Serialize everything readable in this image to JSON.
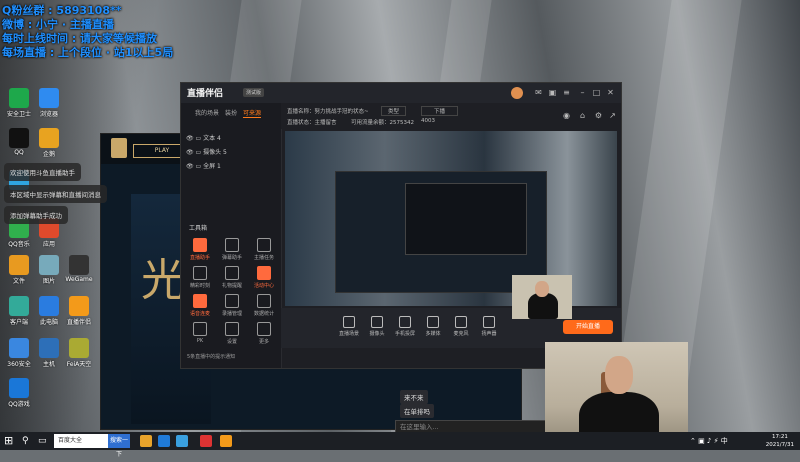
{
  "overlay": {
    "line1": "Q粉丝群 : 5893108**",
    "line2": "微博 : 小宁 · 主播直播",
    "line3": "每时上线时间 : 请大家等候播放",
    "line4": "每场直播 : 上个段位 · 站1以上5局"
  },
  "desktop_icons": [
    {
      "label": "安全卫士",
      "color": "#1ea84b"
    },
    {
      "label": "浏览器",
      "color": "#2f8bf0"
    },
    {
      "label": "QQ",
      "color": "#111"
    },
    {
      "label": "企鹅",
      "color": "#e8a320"
    },
    {
      "label": "TIM",
      "color": "#2fa5e0"
    },
    {
      "label": "QQ音乐",
      "color": "#30b04d"
    },
    {
      "label": "应用",
      "color": "#e04a2c"
    },
    {
      "label": "文件",
      "color": "#e89a20"
    },
    {
      "label": "图片",
      "color": "#7ab"
    },
    {
      "label": "WeGame",
      "color": "#333"
    },
    {
      "label": "客户端",
      "color": "#3a9"
    },
    {
      "label": "此电脑",
      "color": "#2a7ce0"
    },
    {
      "label": "直播伴侣",
      "color": "#f39a1a"
    },
    {
      "label": "360安全",
      "color": "#3a87e0"
    },
    {
      "label": "主机",
      "color": "#2d6fb8"
    },
    {
      "label": "FeiA天空",
      "color": "#aa3"
    },
    {
      "label": "QQ游戏",
      "color": "#1a77d8"
    }
  ],
  "bubbles": {
    "b1": "欢迎使用斗鱼直播助手",
    "b2": "本区域中显示弹幕和直播间消息",
    "b3": "添加弹幕助手成功"
  },
  "game": {
    "play_label": "PLAY",
    "title_char": "光"
  },
  "app": {
    "logo": "直播伴侣",
    "version_badge": "测试版",
    "tabs": [
      "我的场景",
      "装扮",
      "可来源"
    ],
    "sources": [
      "文本 4",
      "摄像头 5",
      "全屏 1"
    ],
    "tools_title": "工具箱",
    "tools": [
      "直播助手",
      "弹幕助手",
      "主播任务",
      "精彩时刻",
      "礼物提醒",
      "活动中心",
      "语音连麦",
      "录播管理",
      "数据统计",
      "PK",
      "设置",
      "更多"
    ],
    "header_title": "直播名称：努力挑战手冠的状态~",
    "header_field": "类型",
    "header_btn": "下播",
    "header_sub1": "直播状态：主播留言",
    "header_sub2": "可用流量余额：2575342",
    "header_sub3": "4003",
    "bottom": [
      "直播场景",
      "摄像头",
      "手机投屏",
      "多媒体",
      "麦克风",
      "扬声器"
    ],
    "start_live": "开始直播",
    "notice": "5条直播中的提示通知"
  },
  "chat": {
    "msg1": "来不来",
    "msg2": "在单排吗",
    "input_placeholder": "在这里输入..."
  },
  "taskbar": {
    "search_text": "百度大全",
    "search_btn": "搜索一下",
    "time": "17:21",
    "date": "2021/7/31"
  }
}
